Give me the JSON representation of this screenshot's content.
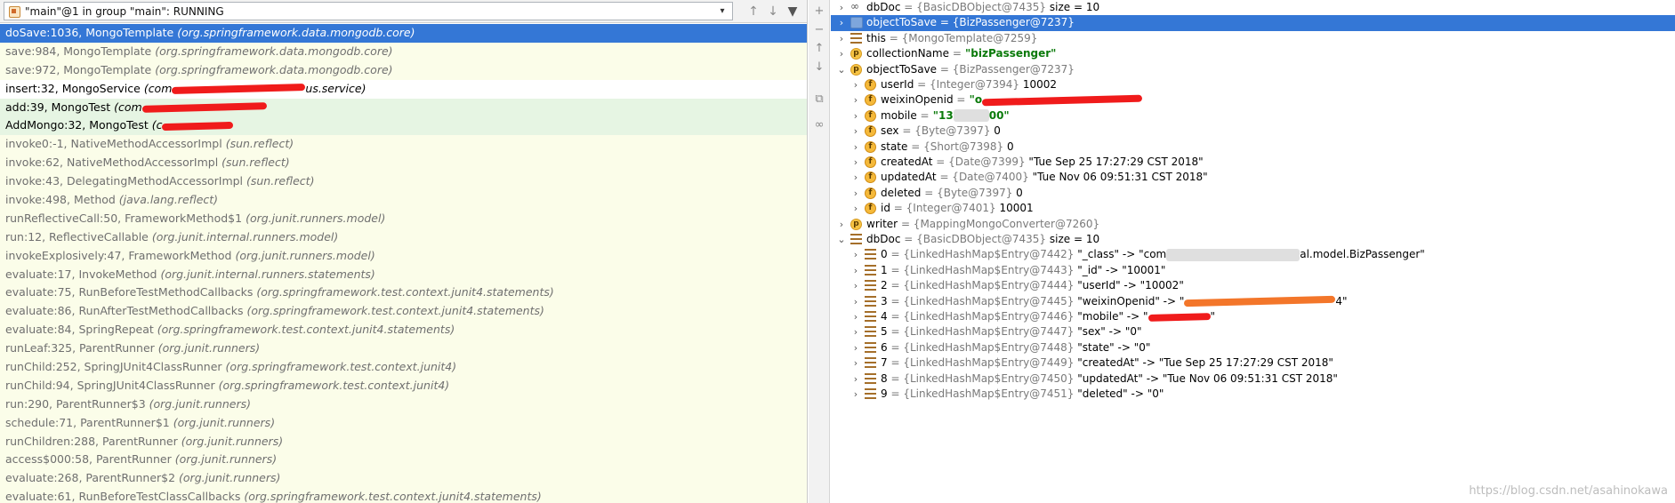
{
  "thread": {
    "label": "\"main\"@1 in group \"main\": RUNNING",
    "chevron": "chevron-down-icon",
    "up": "arrow-up-icon",
    "down": "arrow-down-icon",
    "filter": "filter-icon"
  },
  "frames": [
    {
      "method": "doSave:1036, MongoTemplate",
      "pkg": "(org.springframework.data.mongodb.core)",
      "state": "selected"
    },
    {
      "method": "save:984, MongoTemplate",
      "pkg": "(org.springframework.data.mongodb.core)",
      "state": "lib"
    },
    {
      "method": "save:972, MongoTemplate",
      "pkg": "(org.springframework.data.mongodb.core)",
      "state": "lib"
    },
    {
      "method": "insert:32, MongoService",
      "pkg": "(com",
      "state": "user",
      "redact": 150,
      "pkg2": "us.service)"
    },
    {
      "method": "add:39, MongoTest",
      "pkg": "(com",
      "state": "user-green",
      "redact": 140,
      "pkg2": ""
    },
    {
      "method": "AddMongo:32, MongoTest",
      "pkg": "(c",
      "state": "user-green",
      "redact": 80,
      "pkg2": ""
    },
    {
      "method": "invoke0:-1, NativeMethodAccessorImpl",
      "pkg": "(sun.reflect)",
      "state": "lib"
    },
    {
      "method": "invoke:62, NativeMethodAccessorImpl",
      "pkg": "(sun.reflect)",
      "state": "lib"
    },
    {
      "method": "invoke:43, DelegatingMethodAccessorImpl",
      "pkg": "(sun.reflect)",
      "state": "lib"
    },
    {
      "method": "invoke:498, Method",
      "pkg": "(java.lang.reflect)",
      "state": "lib"
    },
    {
      "method": "runReflectiveCall:50, FrameworkMethod$1",
      "pkg": "(org.junit.runners.model)",
      "state": "lib"
    },
    {
      "method": "run:12, ReflectiveCallable",
      "pkg": "(org.junit.internal.runners.model)",
      "state": "lib"
    },
    {
      "method": "invokeExplosively:47, FrameworkMethod",
      "pkg": "(org.junit.runners.model)",
      "state": "lib"
    },
    {
      "method": "evaluate:17, InvokeMethod",
      "pkg": "(org.junit.internal.runners.statements)",
      "state": "lib"
    },
    {
      "method": "evaluate:75, RunBeforeTestMethodCallbacks",
      "pkg": "(org.springframework.test.context.junit4.statements)",
      "state": "lib"
    },
    {
      "method": "evaluate:86, RunAfterTestMethodCallbacks",
      "pkg": "(org.springframework.test.context.junit4.statements)",
      "state": "lib"
    },
    {
      "method": "evaluate:84, SpringRepeat",
      "pkg": "(org.springframework.test.context.junit4.statements)",
      "state": "lib"
    },
    {
      "method": "runLeaf:325, ParentRunner",
      "pkg": "(org.junit.runners)",
      "state": "lib"
    },
    {
      "method": "runChild:252, SpringJUnit4ClassRunner",
      "pkg": "(org.springframework.test.context.junit4)",
      "state": "lib"
    },
    {
      "method": "runChild:94, SpringJUnit4ClassRunner",
      "pkg": "(org.springframework.test.context.junit4)",
      "state": "lib"
    },
    {
      "method": "run:290, ParentRunner$3",
      "pkg": "(org.junit.runners)",
      "state": "lib"
    },
    {
      "method": "schedule:71, ParentRunner$1",
      "pkg": "(org.junit.runners)",
      "state": "lib"
    },
    {
      "method": "runChildren:288, ParentRunner",
      "pkg": "(org.junit.runners)",
      "state": "lib"
    },
    {
      "method": "access$000:58, ParentRunner",
      "pkg": "(org.junit.runners)",
      "state": "lib"
    },
    {
      "method": "evaluate:268, ParentRunner$2",
      "pkg": "(org.junit.runners)",
      "state": "lib"
    },
    {
      "method": "evaluate:61, RunBeforeTestClassCallbacks",
      "pkg": "(org.springframework.test.context.junit4.statements)",
      "state": "lib"
    }
  ],
  "toolbar_icons": [
    "plus-icon",
    "minus-icon",
    "arrow-up-icon",
    "arrow-down-icon",
    "copy-icon",
    "glasses-icon"
  ],
  "variables": [
    {
      "depth": 0,
      "icon": "watch",
      "name": "dbDoc",
      "type": "= {BasicDBObject@7435}",
      "value": " size = 10",
      "sel": false
    },
    {
      "depth": 0,
      "icon": "sel",
      "name": "objectToSave",
      "type": "= {BizPassenger@7237}",
      "value": "",
      "sel": true
    },
    {
      "depth": 0,
      "icon": "lines",
      "name": "this",
      "type": "= {MongoTemplate@7259}",
      "value": "",
      "sel": false
    },
    {
      "depth": 0,
      "icon": "p",
      "name": "collectionName",
      "type": "=",
      "str": " \"bizPassenger\"",
      "value": "",
      "sel": false
    },
    {
      "depth": 0,
      "icon": "p",
      "name": "objectToSave",
      "type": "= {BizPassenger@7237}",
      "value": "",
      "sel": false,
      "open": true
    },
    {
      "depth": 1,
      "icon": "f",
      "name": "userId",
      "type": "= {Integer@7394}",
      "value": " 10002",
      "sel": false
    },
    {
      "depth": 1,
      "icon": "f",
      "name": "weixinOpenid",
      "type": "=",
      "str": " \"o",
      "value": "",
      "sel": false,
      "redact": 180
    },
    {
      "depth": 1,
      "icon": "f",
      "name": "mobile",
      "type": "=",
      "str": " \"13",
      "str2": "00\"",
      "value": "",
      "sel": false,
      "blur": 40
    },
    {
      "depth": 1,
      "icon": "f",
      "name": "sex",
      "type": "= {Byte@7397}",
      "value": " 0",
      "sel": false
    },
    {
      "depth": 1,
      "icon": "f",
      "name": "state",
      "type": "= {Short@7398}",
      "value": " 0",
      "sel": false
    },
    {
      "depth": 1,
      "icon": "f",
      "name": "createdAt",
      "type": "= {Date@7399}",
      "value": " \"Tue Sep 25 17:27:29 CST 2018\"",
      "sel": false
    },
    {
      "depth": 1,
      "icon": "f",
      "name": "updatedAt",
      "type": "= {Date@7400}",
      "value": " \"Tue Nov 06 09:51:31 CST 2018\"",
      "sel": false
    },
    {
      "depth": 1,
      "icon": "f",
      "name": "deleted",
      "type": "= {Byte@7397}",
      "value": " 0",
      "sel": false
    },
    {
      "depth": 1,
      "icon": "f",
      "name": "id",
      "type": "= {Integer@7401}",
      "value": " 10001",
      "sel": false
    },
    {
      "depth": 0,
      "icon": "p",
      "name": "writer",
      "type": "= {MappingMongoConverter@7260}",
      "value": "",
      "sel": false
    },
    {
      "depth": 0,
      "icon": "lines",
      "name": "dbDoc",
      "type": "= {BasicDBObject@7435}",
      "value": " size = 10",
      "sel": false,
      "open": true
    },
    {
      "depth": 1,
      "icon": "lines",
      "name": "0",
      "type": "= {LinkedHashMap$Entry@7442}",
      "value": " \"_class\" -> \"com",
      "value2": "al.model.BizPassenger\"",
      "sel": false,
      "blur": 150
    },
    {
      "depth": 1,
      "icon": "lines",
      "name": "1",
      "type": "= {LinkedHashMap$Entry@7443}",
      "value": " \"_id\" -> \"10001\"",
      "sel": false
    },
    {
      "depth": 1,
      "icon": "lines",
      "name": "2",
      "type": "= {LinkedHashMap$Entry@7444}",
      "value": " \"userId\" -> \"10002\"",
      "sel": false
    },
    {
      "depth": 1,
      "icon": "lines",
      "name": "3",
      "type": "= {LinkedHashMap$Entry@7445}",
      "value": " \"weixinOpenid\" -> \"",
      "value2": "4\"",
      "sel": false,
      "redact": 170,
      "redactColor": "#f3762a"
    },
    {
      "depth": 1,
      "icon": "lines",
      "name": "4",
      "type": "= {LinkedHashMap$Entry@7446}",
      "value": " \"mobile\" -> \"",
      "value2": "\"",
      "sel": false,
      "redact": 70
    },
    {
      "depth": 1,
      "icon": "lines",
      "name": "5",
      "type": "= {LinkedHashMap$Entry@7447}",
      "value": " \"sex\" -> \"0\"",
      "sel": false
    },
    {
      "depth": 1,
      "icon": "lines",
      "name": "6",
      "type": "= {LinkedHashMap$Entry@7448}",
      "value": " \"state\" -> \"0\"",
      "sel": false
    },
    {
      "depth": 1,
      "icon": "lines",
      "name": "7",
      "type": "= {LinkedHashMap$Entry@7449}",
      "value": " \"createdAt\" -> \"Tue Sep 25 17:27:29 CST 2018\"",
      "sel": false
    },
    {
      "depth": 1,
      "icon": "lines",
      "name": "8",
      "type": "= {LinkedHashMap$Entry@7450}",
      "value": " \"updatedAt\" -> \"Tue Nov 06 09:51:31 CST 2018\"",
      "sel": false
    },
    {
      "depth": 1,
      "icon": "lines",
      "name": "9",
      "type": "= {LinkedHashMap$Entry@7451}",
      "value": " \"deleted\" -> \"0\"",
      "sel": false
    }
  ],
  "watermark": "https://blog.csdn.net/asahinokawa",
  "colors": {
    "selection": "#3477d6",
    "lib_frame": "#fbfde9",
    "user_green": "#e6f5e3",
    "string": "#0a7a0a",
    "redaction": "#f01b1b"
  }
}
